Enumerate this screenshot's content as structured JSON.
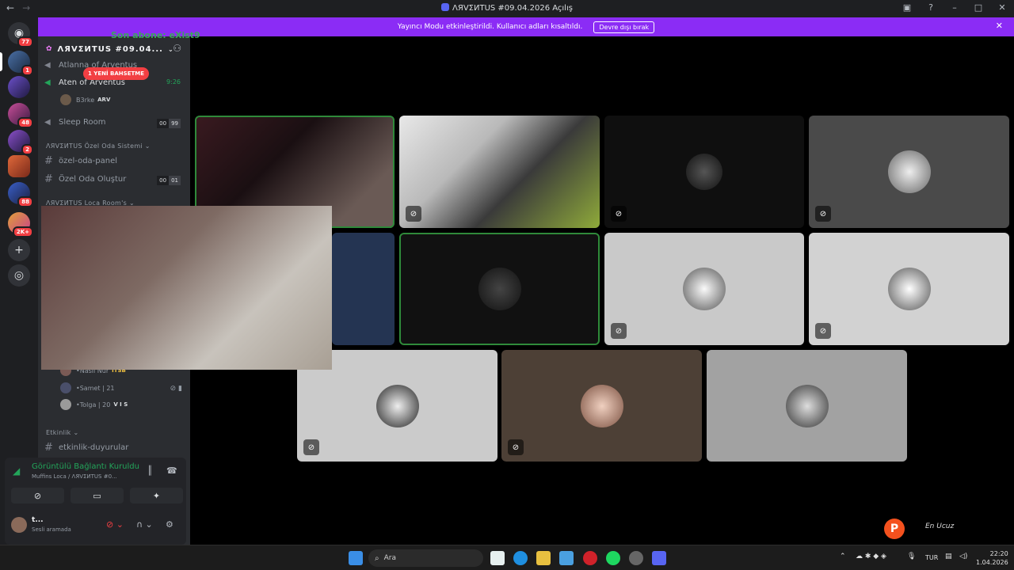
{
  "window": {
    "title": "ΛЯVΣИTUS #09.04.2026 Açılış"
  },
  "banner": {
    "text": "Yayıncı Modu etkinleştirildi. Kullanıcı adları kısaltıldı.",
    "button": "Devre dışı bırak"
  },
  "rail": {
    "home_badge": "77",
    "badges": [
      "1",
      "48",
      "2",
      "88",
      "2K+"
    ]
  },
  "overlay": {
    "sub_text": "Son abone: eXist9"
  },
  "server": {
    "name": "ΛЯVΣИTUS #09.04..."
  },
  "mention": "1 YENİ BAHSETME",
  "channels": {
    "atlanna": "Atlanna of Arventus",
    "aten": "Aten of Arventus",
    "aten_time": "9:26",
    "aten_user": "B3rke",
    "aten_user_tag": "ARV",
    "sleep": "Sleep Room",
    "sleep_count": [
      "00",
      "99"
    ],
    "cat_ozel": "ΛЯVΣИTUS Özel Oda Sistemi",
    "ozel_panel": "özel-oda-panel",
    "ozel_create": "Özel Oda Oluştur",
    "ozel_count": [
      "00",
      "01"
    ],
    "cat_loca": "ΛЯVΣИTUS Loca Room's",
    "cat_etkinlik": "Etkinlik",
    "etkinlik_duyuru": "etkinlik-duyurular"
  },
  "voice_users": [
    {
      "name": "Naslı Nur",
      "tag": "ITSB"
    },
    {
      "name": "Samet | 21",
      "tag": ""
    },
    {
      "name": "Tolga | 20",
      "tag": "V I S"
    }
  ],
  "voice": {
    "status": "Görüntülü Bağlantı Kuruldu",
    "channel": "Muffins Loca / ΛЯVΣИTUS #0..."
  },
  "user": {
    "name": "t...",
    "status": "Sesli aramada"
  },
  "taskbar": {
    "search": "Ara",
    "lang": "TUR",
    "time": "22:20",
    "date": "1.04.2026"
  },
  "colors": {
    "accent": "#5865f2",
    "banner": "#8b2cf5",
    "online": "#23a55a",
    "danger": "#f23f43"
  }
}
